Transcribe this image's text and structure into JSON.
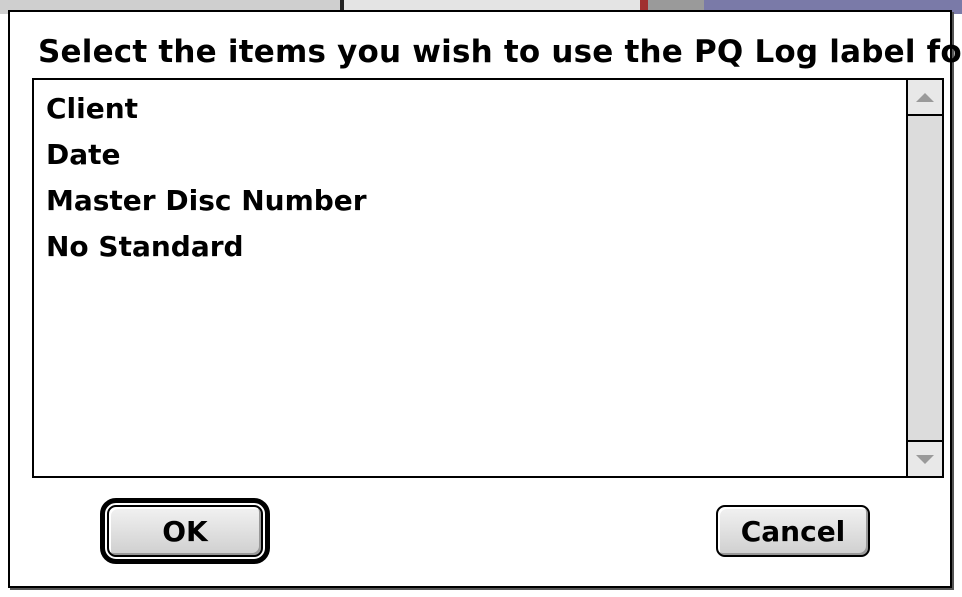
{
  "dialog": {
    "prompt": "Select the items you wish to use the PQ Log label for",
    "list": {
      "items": [
        "Client",
        "Date",
        "Master Disc Number",
        "No Standard"
      ]
    },
    "buttons": {
      "ok": "OK",
      "cancel": "Cancel"
    }
  }
}
